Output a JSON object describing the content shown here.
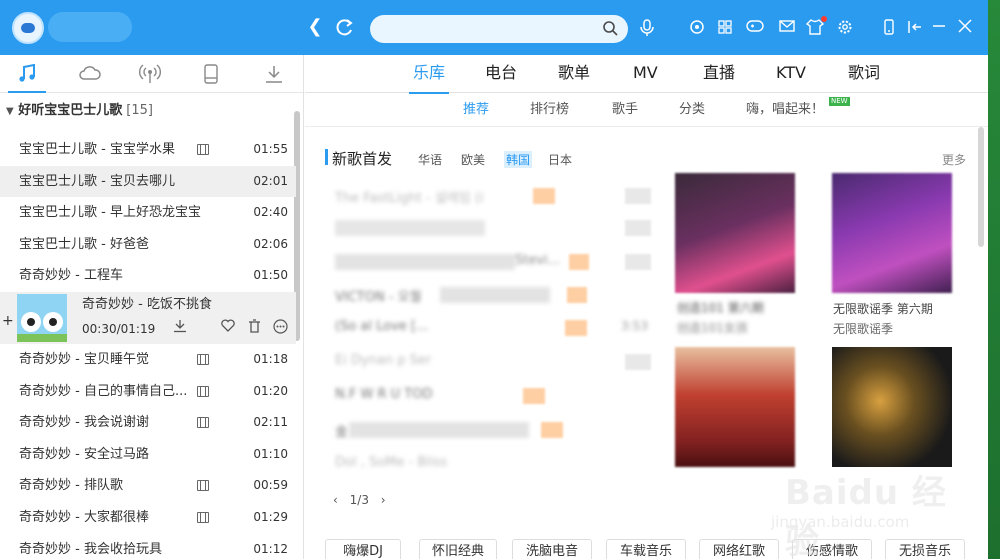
{
  "titlebar": {
    "search_placeholder": "",
    "icons": [
      "back-icon",
      "refresh-icon",
      "mic-icon",
      "skin-icon",
      "apps-icon",
      "game-icon",
      "mail-icon",
      "shirt-icon",
      "gear-icon",
      "phone-icon",
      "mini-mode-icon",
      "minimize-icon",
      "close-icon"
    ]
  },
  "sidebar": {
    "tabs": [
      "music-note-icon",
      "cloud-icon",
      "radio-icon",
      "device-icon",
      "download-icon"
    ],
    "playlist": {
      "name": "好听宝宝巴士儿歌",
      "count": "[15]"
    },
    "songs": [
      {
        "title": "宝宝巴士儿歌 - 宝宝学水果",
        "mv": true,
        "duration": "01:55"
      },
      {
        "title": "宝宝巴士儿歌 - 宝贝去哪儿",
        "mv": false,
        "duration": "02:01"
      },
      {
        "title": "宝宝巴士儿歌 - 早上好恐龙宝宝",
        "mv": false,
        "duration": "02:40"
      },
      {
        "title": "宝宝巴士儿歌 - 好爸爸",
        "mv": false,
        "duration": "02:06"
      },
      {
        "title": "奇奇妙妙 - 工程车",
        "mv": false,
        "duration": "01:50"
      }
    ],
    "now_playing": {
      "title": "奇奇妙妙 - 吃饭不挑食",
      "time": "00:30/01:19"
    },
    "songs_after": [
      {
        "title": "奇奇妙妙 - 宝贝睡午觉",
        "mv": true,
        "duration": "01:18"
      },
      {
        "title": "奇奇妙妙 - 自己的事情自己...",
        "mv": true,
        "duration": "01:20"
      },
      {
        "title": "奇奇妙妙 - 我会说谢谢",
        "mv": true,
        "duration": "02:11"
      },
      {
        "title": "奇奇妙妙 - 安全过马路",
        "mv": false,
        "duration": "01:10"
      },
      {
        "title": "奇奇妙妙 - 排队歌",
        "mv": true,
        "duration": "00:59"
      },
      {
        "title": "奇奇妙妙 - 大家都很棒",
        "mv": true,
        "duration": "01:29"
      },
      {
        "title": "奇奇妙妙 - 我会收拾玩具",
        "mv": false,
        "duration": "01:12"
      }
    ]
  },
  "main": {
    "tabs": [
      {
        "label": "乐库",
        "active": true
      },
      {
        "label": "电台",
        "active": false
      },
      {
        "label": "歌单",
        "active": false
      },
      {
        "label": "MV",
        "active": false
      },
      {
        "label": "直播",
        "active": false
      },
      {
        "label": "KTV",
        "active": false
      },
      {
        "label": "歌词",
        "active": false
      }
    ],
    "subtabs": [
      {
        "label": "推荐",
        "active": true
      },
      {
        "label": "排行榜",
        "active": false
      },
      {
        "label": "歌手",
        "active": false
      },
      {
        "label": "分类",
        "active": false
      },
      {
        "label": "嗨，唱起来！",
        "active": false
      }
    ],
    "new_badge": "NEW",
    "section_title": "新歌首发",
    "filters": [
      {
        "label": "华语",
        "active": false
      },
      {
        "label": "欧美",
        "active": false
      },
      {
        "label": "韩国",
        "active": true
      },
      {
        "label": "日本",
        "active": false
      }
    ],
    "more": "更多",
    "new_songs": [
      "The FastLight - 설레임 (i",
      "",
      "",
      "VICTON - 오월",
      "(So                    al Love [...",
      "Ei    Dynan         p Ser",
      "N.F                  W R U TOD",
      "金",
      "Dol    , SoMe  - Bliss"
    ],
    "new_song_dur": "3:53",
    "stevie_text": "Stevi...",
    "pager": "1/3",
    "albums": [
      {
        "title": "创造101 第六期",
        "sub": "创造101女孩"
      },
      {
        "title": "无限歌谣季 第六期",
        "sub": "无限歌谣季"
      }
    ],
    "genres": [
      "嗨爆DJ",
      "怀旧经典",
      "洗脑电音",
      "车载音乐",
      "网络红歌",
      "伤感情歌",
      "无损音乐"
    ]
  },
  "watermark": {
    "brand": "Baidu 经验",
    "url": "jingyan.baidu.com"
  },
  "colors": {
    "accent": "#2b9bf0",
    "titlebar": "#2b9bf0",
    "selected_row": "#efefef"
  }
}
